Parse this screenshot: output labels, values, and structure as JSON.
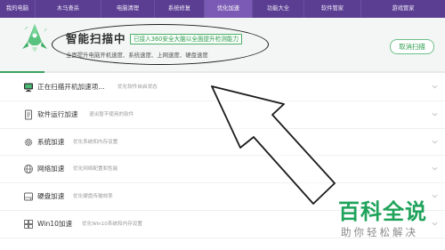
{
  "nav": {
    "tabs": [
      "我的电脑",
      "木马查杀",
      "电脑清理",
      "系统修复",
      "优化加速",
      "功能大全",
      "软件管家",
      "游戏管家"
    ],
    "active_tab": "优化加速"
  },
  "scan": {
    "title": "智能扫描中",
    "badge": "已接入360安全大脑以全面提升检测能力",
    "subtitle": "全面提升电脑开机速度、系统速度、上网速度、硬盘速度",
    "cancel_label": "取消扫描",
    "progress_fraction": 0.1
  },
  "items": [
    {
      "title": "正在扫描开机加速项...",
      "desc": "优化软件自启状态",
      "icon": "monitor-icon"
    },
    {
      "title": "软件运行加速",
      "desc": "退出暂不使用的软件",
      "icon": "document-icon"
    },
    {
      "title": "系统加速",
      "desc": "优化系统和内存设置",
      "icon": "gear-icon"
    },
    {
      "title": "网络加速",
      "desc": "优化网络配置和性能",
      "icon": "network-icon"
    },
    {
      "title": "硬盘加速",
      "desc": "优化硬盘传输效率",
      "icon": "disk-icon"
    },
    {
      "title": "Win10加速",
      "desc": "优化Win10系统和内存设置",
      "icon": "windows-icon"
    }
  ],
  "watermark": {
    "title": "百科全说",
    "subtitle": "助你轻松解决"
  },
  "colors": {
    "nav_bg": "#5b3e92",
    "nav_active": "#7a5ab4",
    "accent_green": "#2f9d4f"
  }
}
